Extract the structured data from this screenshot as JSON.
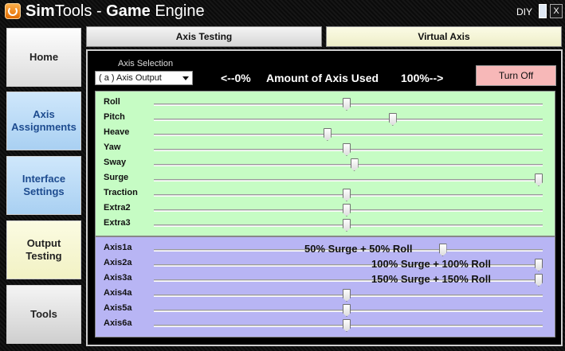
{
  "app": {
    "title_brand": "Sim",
    "title_brand2": "Tools",
    "title_sep": " - ",
    "title_app1": "Game",
    "title_app2": " Engine",
    "diy_label": "DIY",
    "close_label": "X"
  },
  "nav": {
    "home": "Home",
    "axis_line1": "Axis",
    "axis_line2": "Assignments",
    "interface_line1": "Interface",
    "interface_line2": "Settings",
    "output_line1": "Output",
    "output_line2": "Testing",
    "tools": "Tools"
  },
  "tabs": {
    "axis_testing": "Axis Testing",
    "virtual_axis": "Virtual Axis"
  },
  "controls": {
    "axis_selection_label": "Axis Selection",
    "axis_selection_value": "( a ) Axis Output",
    "amount_left": "<--0%",
    "amount_label": "Amount of Axis Used",
    "amount_right": "100%-->",
    "turn_off": "Turn Off"
  },
  "axes": [
    {
      "label": "Roll",
      "level": 0.5
    },
    {
      "label": "Pitch",
      "level": 0.62
    },
    {
      "label": "Heave",
      "level": 0.45
    },
    {
      "label": "Yaw",
      "level": 0.5
    },
    {
      "label": "Sway",
      "level": 0.52
    },
    {
      "label": "Surge",
      "level": 1.0
    },
    {
      "label": "Traction",
      "level": 0.5
    },
    {
      "label": "Extra2",
      "level": 0.5
    },
    {
      "label": "Extra3",
      "level": 0.5
    }
  ],
  "virtual_axes": [
    {
      "label": "Axis1a",
      "level": 0.75,
      "note": "50% Surge + 50% Roll"
    },
    {
      "label": "Axis2a",
      "level": 1.0,
      "note": "100% Surge + 100% Roll"
    },
    {
      "label": "Axis3a",
      "level": 1.0,
      "note": "150% Surge + 150% Roll"
    },
    {
      "label": "Axis4a",
      "level": 0.5,
      "note": ""
    },
    {
      "label": "Axis5a",
      "level": 0.5,
      "note": ""
    },
    {
      "label": "Axis6a",
      "level": 0.5,
      "note": ""
    }
  ]
}
